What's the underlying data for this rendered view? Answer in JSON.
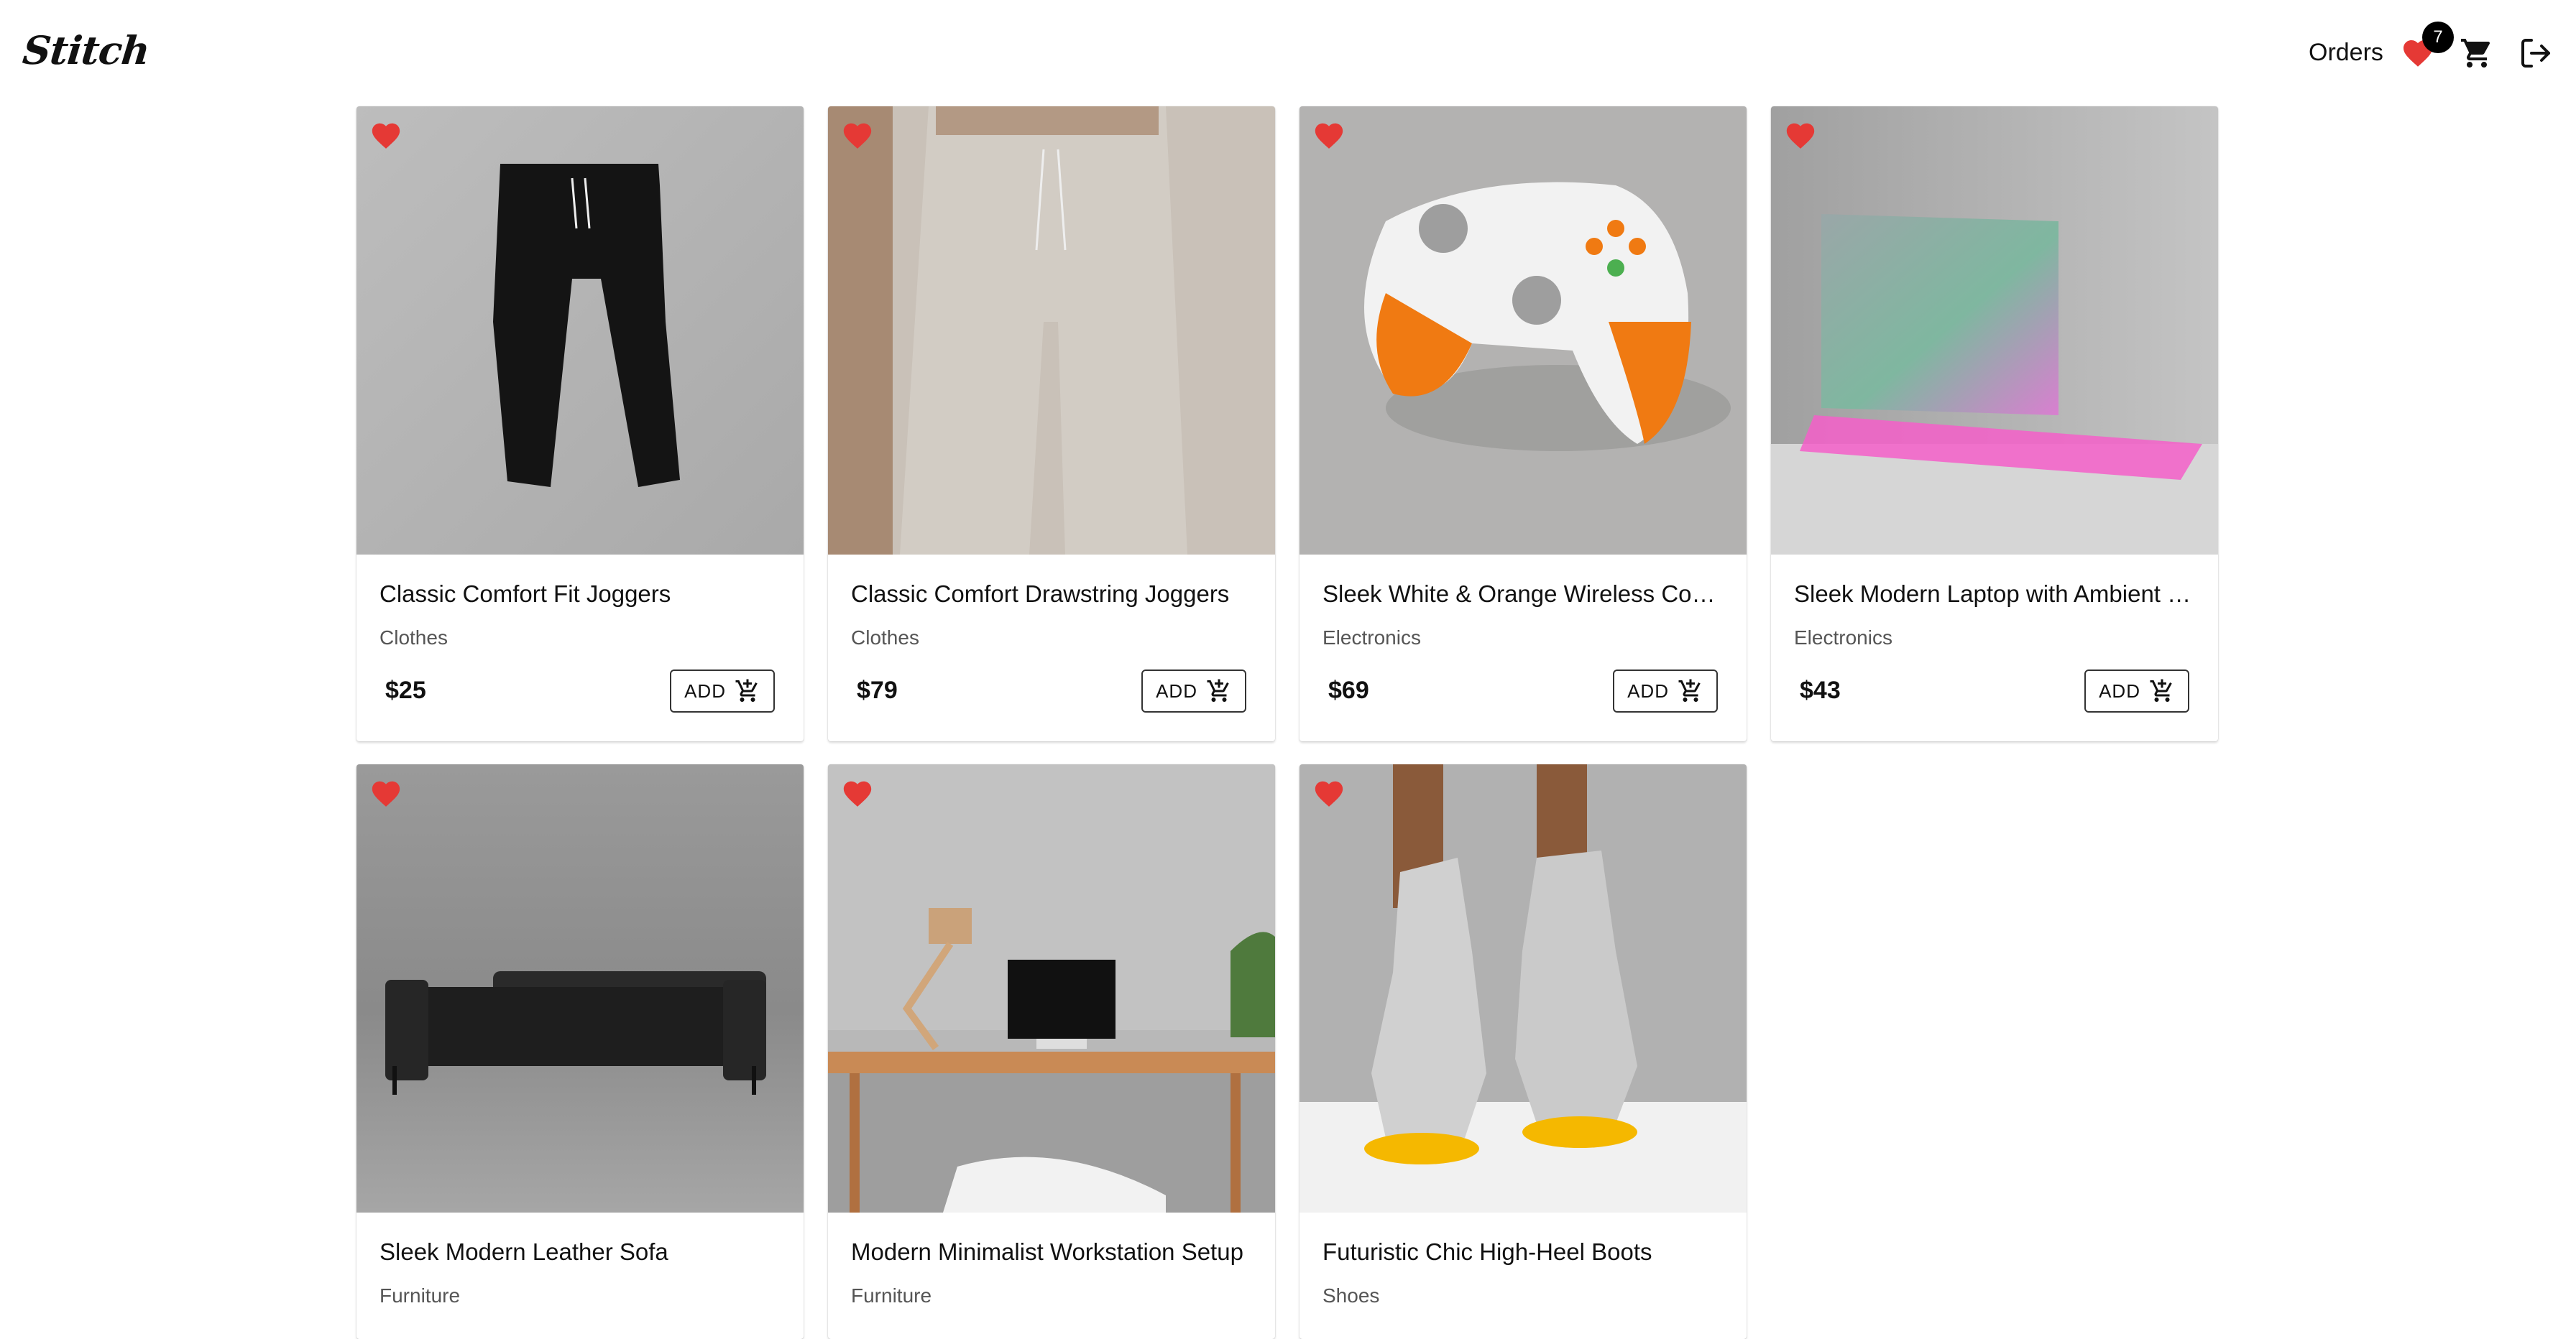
{
  "header": {
    "logo": "Stitch",
    "orders_label": "Orders",
    "favorites_count": "7",
    "icons": [
      "heart-icon",
      "cart-icon",
      "logout-icon"
    ],
    "accent_color": "#e53935"
  },
  "products": [
    {
      "title": "Classic Comfort Fit Joggers",
      "category": "Clothes",
      "price": "$25",
      "add_label": "ADD"
    },
    {
      "title": "Classic Comfort Drawstring Joggers",
      "category": "Clothes",
      "price": "$79",
      "add_label": "ADD"
    },
    {
      "title": "Sleek White & Orange Wireless Controller",
      "category": "Electronics",
      "price": "$69",
      "add_label": "ADD"
    },
    {
      "title": "Sleek Modern Laptop with Ambient Lighting",
      "category": "Electronics",
      "price": "$43",
      "add_label": "ADD"
    },
    {
      "title": "Sleek Modern Leather Sofa",
      "category": "Furniture"
    },
    {
      "title": "Modern Minimalist Workstation Setup",
      "category": "Furniture"
    },
    {
      "title": "Futuristic Chic High-Heel Boots",
      "category": "Shoes"
    }
  ]
}
